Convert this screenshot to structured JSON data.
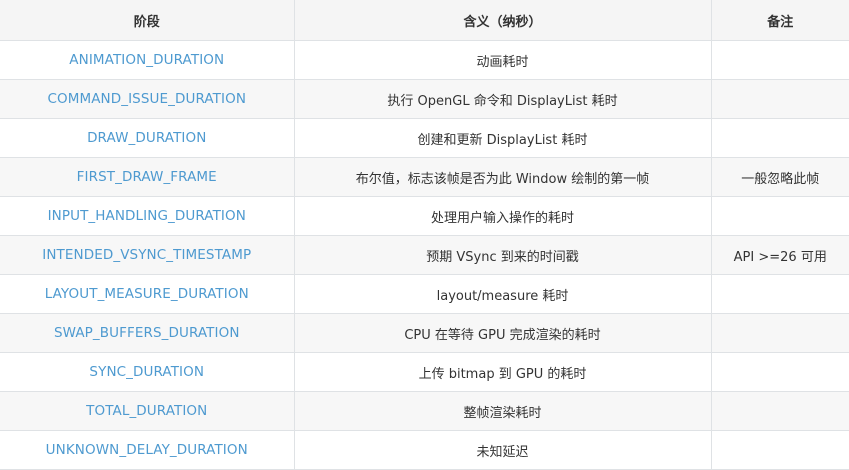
{
  "table": {
    "headers": [
      "阶段",
      "含义（纳秒）",
      "备注"
    ],
    "rows": [
      {
        "phase": "ANIMATION_DURATION",
        "meaning": "动画耗时",
        "note": ""
      },
      {
        "phase": "COMMAND_ISSUE_DURATION",
        "meaning": "执行 OpenGL 命令和 DisplayList 耗时",
        "note": ""
      },
      {
        "phase": "DRAW_DURATION",
        "meaning": "创建和更新 DisplayList 耗时",
        "note": ""
      },
      {
        "phase": "FIRST_DRAW_FRAME",
        "meaning": "布尔值，标志该帧是否为此 Window 绘制的第一帧",
        "note": "一般忽略此帧"
      },
      {
        "phase": "INPUT_HANDLING_DURATION",
        "meaning": "处理用户输入操作的耗时",
        "note": ""
      },
      {
        "phase": "INTENDED_VSYNC_TIMESTAMP",
        "meaning": "预期 VSync 到来的时间戳",
        "note": "API >=26 可用"
      },
      {
        "phase": "LAYOUT_MEASURE_DURATION",
        "meaning": "layout/measure 耗时",
        "note": ""
      },
      {
        "phase": "SWAP_BUFFERS_DURATION",
        "meaning": "CPU 在等待 GPU 完成渲染的耗时",
        "note": ""
      },
      {
        "phase": "SYNC_DURATION",
        "meaning": "上传 bitmap 到 GPU 的耗时",
        "note": ""
      },
      {
        "phase": "TOTAL_DURATION",
        "meaning": "整帧渲染耗时",
        "note": ""
      },
      {
        "phase": "UNKNOWN_DELAY_DURATION",
        "meaning": "未知延迟",
        "note": ""
      }
    ]
  },
  "colors": {
    "phase_text": "#4e9ad0",
    "body_text": "#333333",
    "header_bg": "#f5f5f5",
    "stripe_bg": "#f7f7f7",
    "border": "#dfe2e5"
  }
}
